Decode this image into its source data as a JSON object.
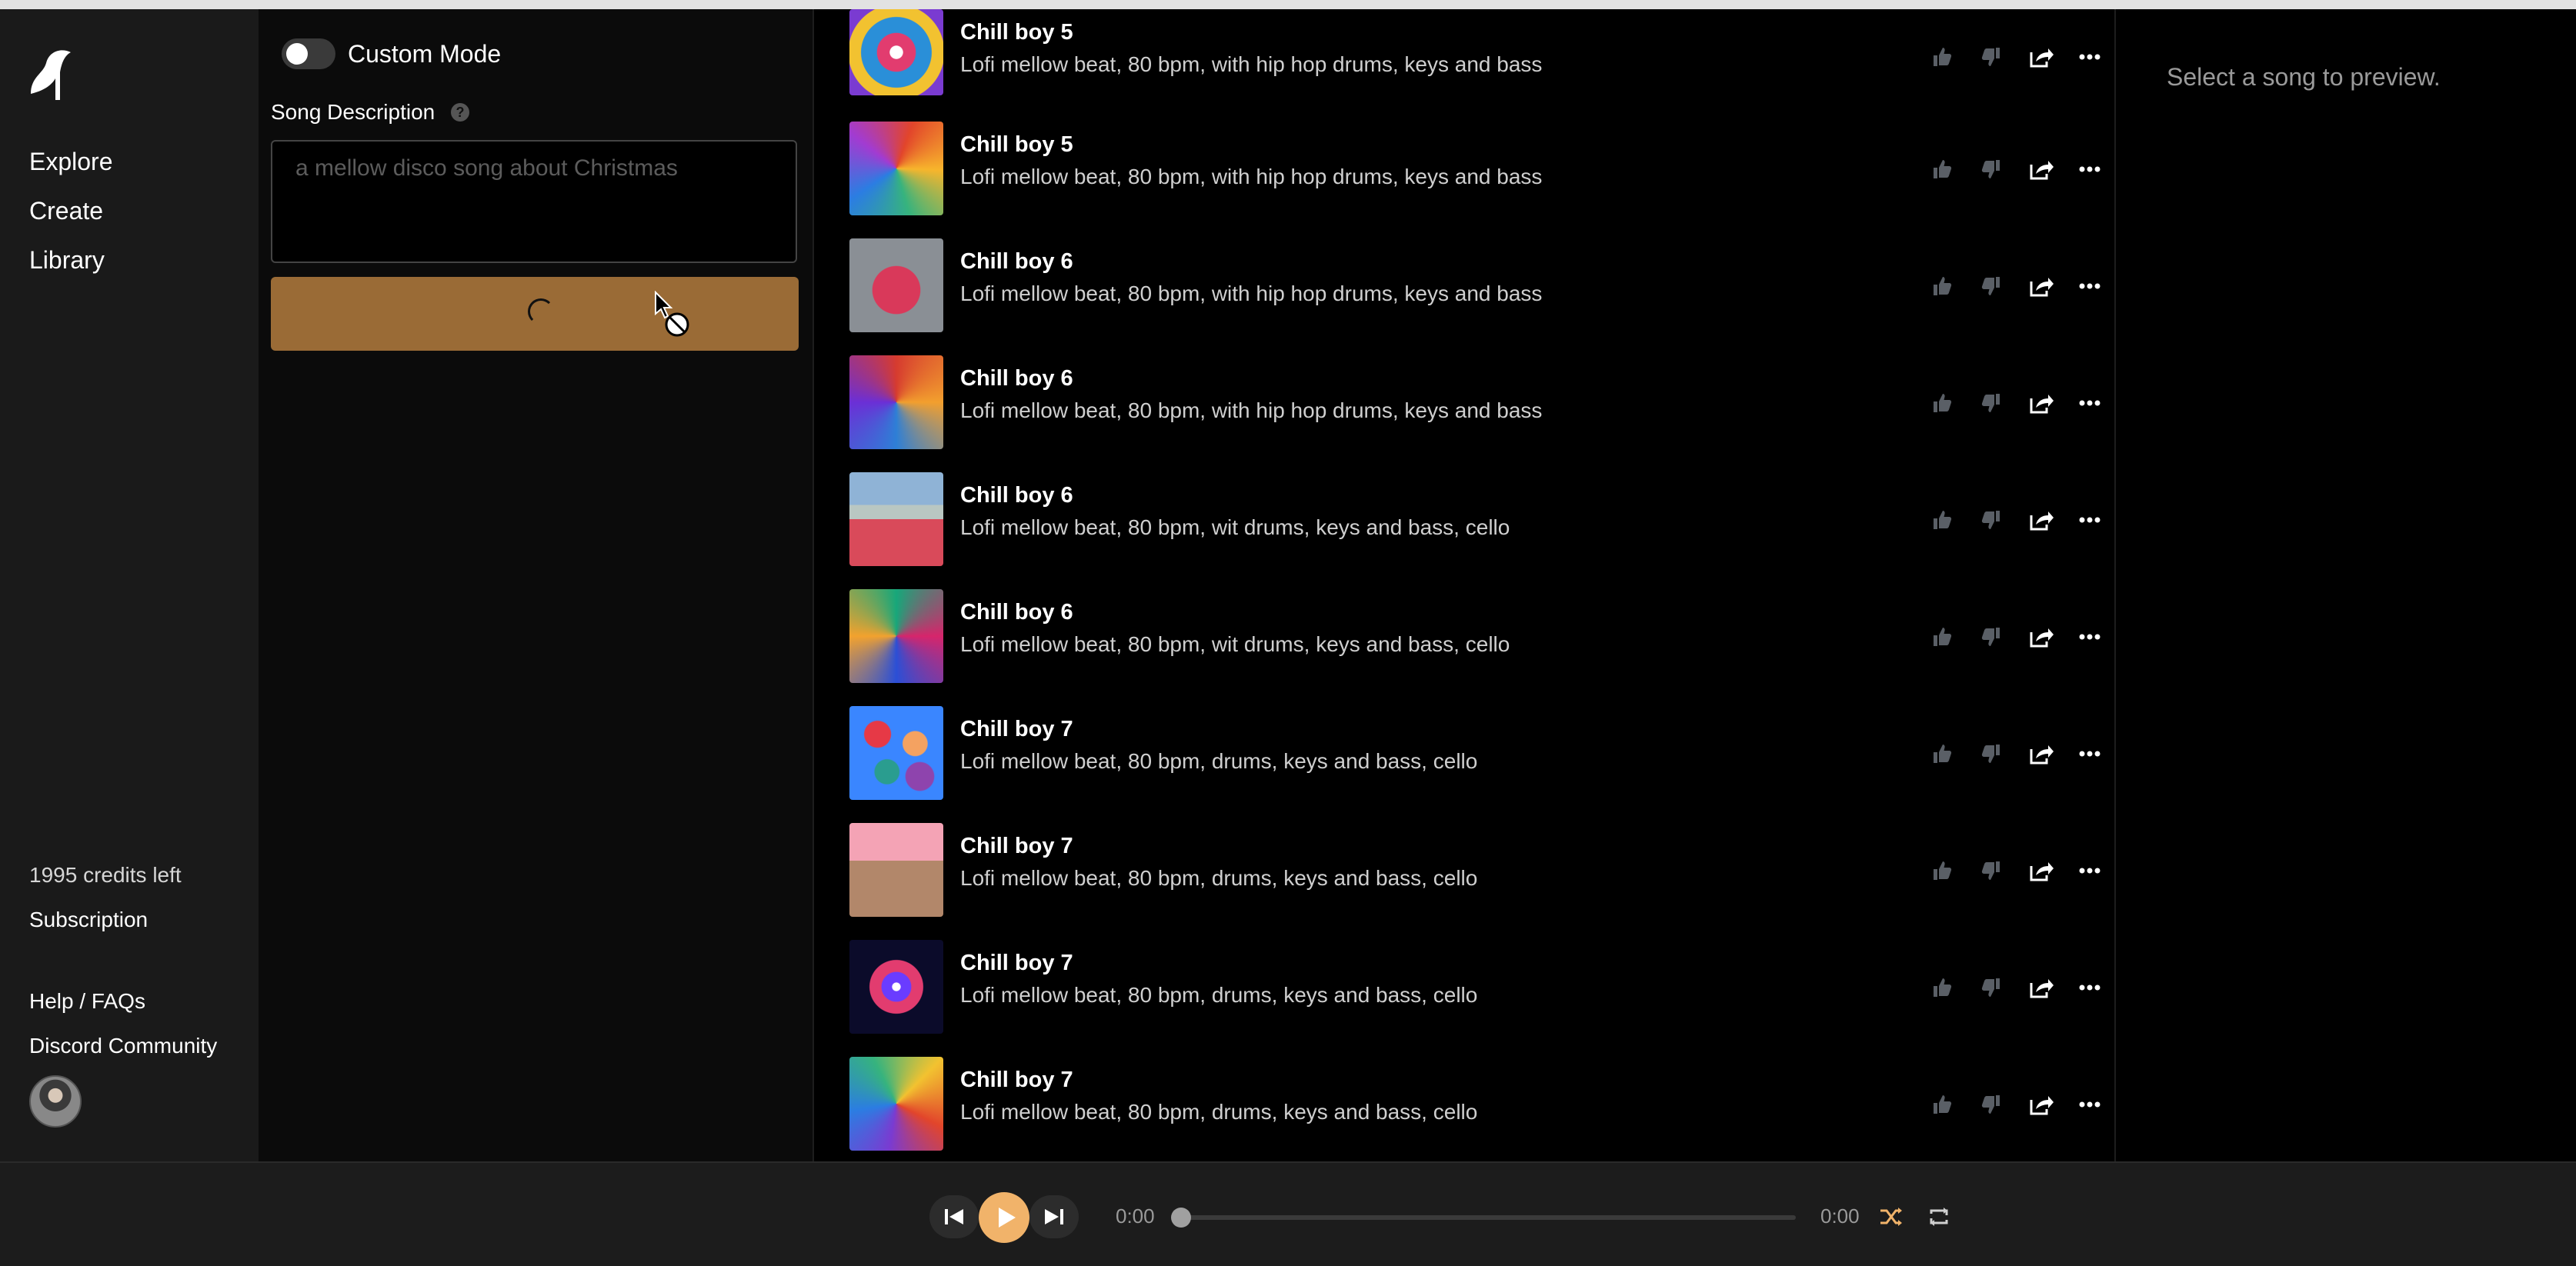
{
  "nav": {
    "links": [
      "Explore",
      "Create",
      "Library"
    ],
    "credits": "1995 credits left",
    "subscription": "Subscription",
    "help": "Help / FAQs",
    "discord": "Discord Community"
  },
  "create": {
    "custom_mode_label": "Custom Mode",
    "custom_mode_on": false,
    "song_description_label": "Song Description",
    "description_placeholder": "a mellow disco song about Christmas",
    "description_value": ""
  },
  "songs": [
    {
      "title": "Chill boy 5",
      "description": "Lofi mellow beat, 80 bpm, with hip hop drums, keys and bass"
    },
    {
      "title": "Chill boy 5",
      "description": "Lofi mellow beat, 80 bpm, with hip hop drums, keys and bass"
    },
    {
      "title": "Chill boy 6",
      "description": "Lofi mellow beat, 80 bpm, with hip hop drums, keys and bass"
    },
    {
      "title": "Chill boy 6",
      "description": "Lofi mellow beat, 80 bpm, with hip hop drums, keys and bass"
    },
    {
      "title": "Chill boy 6",
      "description": "Lofi mellow beat, 80 bpm, wit drums, keys and bass, cello"
    },
    {
      "title": "Chill boy 6",
      "description": "Lofi mellow beat, 80 bpm, wit drums, keys and bass, cello"
    },
    {
      "title": "Chill boy 7",
      "description": "Lofi mellow beat, 80 bpm, drums, keys and bass, cello"
    },
    {
      "title": "Chill boy 7",
      "description": "Lofi mellow beat, 80 bpm, drums, keys and bass, cello"
    },
    {
      "title": "Chill boy 7",
      "description": "Lofi mellow beat, 80 bpm, drums, keys and bass, cello"
    },
    {
      "title": "Chill boy 7",
      "description": "Lofi mellow beat, 80 bpm, drums, keys and bass, cello"
    }
  ],
  "icons": {
    "like": "thumbs-up-icon",
    "dislike": "thumbs-down-icon",
    "share": "share-icon",
    "more": "more-icon"
  },
  "preview": {
    "text": "Select a song to preview."
  },
  "player": {
    "current_time": "0:00",
    "duration": "0:00",
    "progress": 0
  },
  "colors": {
    "create_button": "#9a6b36",
    "play_button": "#f1b36a",
    "shuffle": "#f1b36a"
  }
}
